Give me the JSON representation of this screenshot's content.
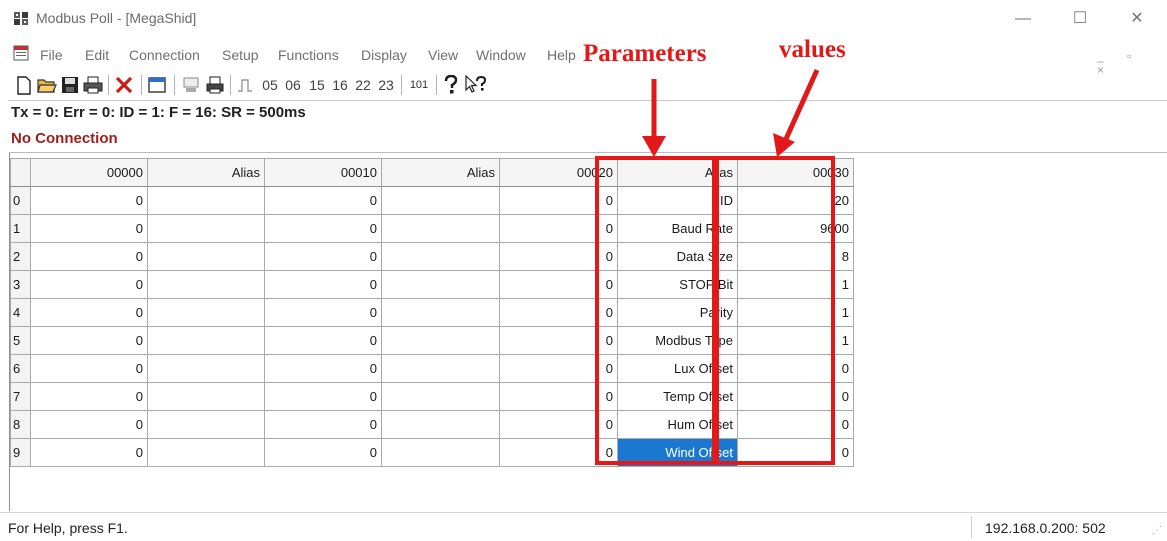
{
  "window": {
    "title": "Modbus Poll - [MegaShid]",
    "controls": {
      "minimize": "—",
      "maximize": "☐",
      "close": "✕"
    },
    "mdi_controls": "_ ▫ ×"
  },
  "menu": [
    "File",
    "Edit",
    "Connection",
    "Setup",
    "Functions",
    "Display",
    "View",
    "Window",
    "Help"
  ],
  "toolbar": {
    "icons": [
      "new-icon",
      "open-icon",
      "save-icon",
      "print-icon",
      "delete-icon",
      "window-icon",
      "read-icon",
      "write-icon",
      "pulse-icon"
    ],
    "function_codes": [
      "05",
      "06",
      "15",
      "16",
      "22",
      "23"
    ],
    "code_101": "101",
    "help_icons": [
      "help-icon",
      "context-help-icon"
    ]
  },
  "status_line": "Tx = 0: Err = 0: ID = 1: F = 16: SR = 500ms",
  "connection_status": "No Connection",
  "grid": {
    "headers": [
      "00000",
      "Alias",
      "00010",
      "Alias",
      "00020",
      "Alias",
      "00030"
    ],
    "rows": [
      {
        "n": "0",
        "v0": "0",
        "a0": "",
        "v1": "0",
        "a1": "",
        "v2": "0",
        "alias": "ID",
        "val": "20"
      },
      {
        "n": "1",
        "v0": "0",
        "a0": "",
        "v1": "0",
        "a1": "",
        "v2": "0",
        "alias": "Baud Rate",
        "val": "9600"
      },
      {
        "n": "2",
        "v0": "0",
        "a0": "",
        "v1": "0",
        "a1": "",
        "v2": "0",
        "alias": "Data Size",
        "val": "8"
      },
      {
        "n": "3",
        "v0": "0",
        "a0": "",
        "v1": "0",
        "a1": "",
        "v2": "0",
        "alias": "STOP Bit",
        "val": "1"
      },
      {
        "n": "4",
        "v0": "0",
        "a0": "",
        "v1": "0",
        "a1": "",
        "v2": "0",
        "alias": "Parity",
        "val": "1"
      },
      {
        "n": "5",
        "v0": "0",
        "a0": "",
        "v1": "0",
        "a1": "",
        "v2": "0",
        "alias": "Modbus Type",
        "val": "1"
      },
      {
        "n": "6",
        "v0": "0",
        "a0": "",
        "v1": "0",
        "a1": "",
        "v2": "0",
        "alias": "Lux Offset",
        "val": "0"
      },
      {
        "n": "7",
        "v0": "0",
        "a0": "",
        "v1": "0",
        "a1": "",
        "v2": "0",
        "alias": "Temp Offset",
        "val": "0"
      },
      {
        "n": "8",
        "v0": "0",
        "a0": "",
        "v1": "0",
        "a1": "",
        "v2": "0",
        "alias": "Hum Offset",
        "val": "0"
      },
      {
        "n": "9",
        "v0": "0",
        "a0": "",
        "v1": "0",
        "a1": "",
        "v2": "0",
        "alias": "Wind Offset",
        "val": "0"
      }
    ],
    "selected_row": 9
  },
  "annotations": {
    "parameters_label": "Parameters",
    "values_label": "values",
    "color": "#e31818"
  },
  "statusbar": {
    "help": "For Help, press F1.",
    "address": "192.168.0.200: 502"
  },
  "colors": {
    "selection": "#1b78d1",
    "connection_error": "#a01e1e"
  }
}
